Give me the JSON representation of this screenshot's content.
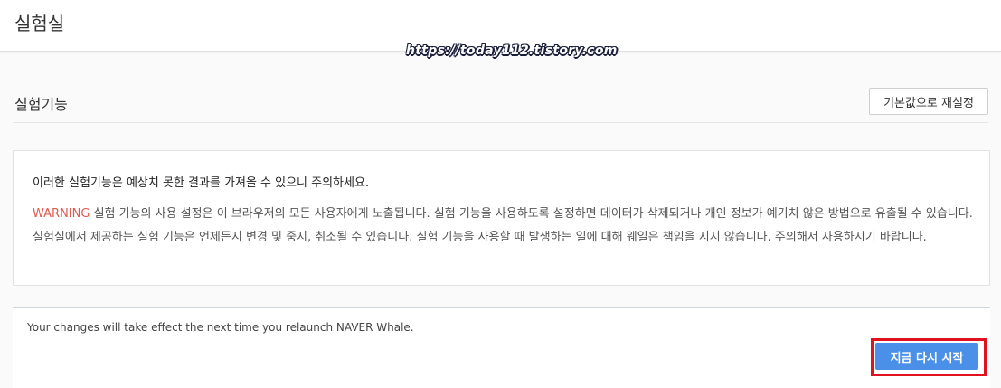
{
  "header": {
    "title": "실험실"
  },
  "watermark": {
    "text": "https://today112.tistory.com"
  },
  "section": {
    "title": "실험기능",
    "reset_label": "기본값으로 재설정"
  },
  "warning": {
    "intro": "이러한 실험기능은 예상치 못한 결과를 가져올 수 있으니 주의하세요.",
    "label": "WARNING",
    "body": " 실험 기능의 사용 설정은 이 브라우저의 모든 사용자에게 노출됩니다. 실험 기능을 사용하도록 설정하면 데이터가 삭제되거나 개인 정보가 예기치 않은 방법으로 유출될 수 있습니다. 실험실에서 제공하는 실험 기능은 언제든지 변경 및 중지, 취소될 수 있습니다. 실험 기능을 사용할 때 발생하는 일에 대해 웨일은 책임을 지지 않습니다. 주의해서 사용하시기 바랍니다.",
    "label_color": "#e05a4f"
  },
  "relaunch": {
    "message": "Your changes will take effect the next time you relaunch NAVER Whale.",
    "button_label": "지금 다시 시작",
    "button_color": "#4a90e8",
    "highlight_color": "#e0121f"
  }
}
